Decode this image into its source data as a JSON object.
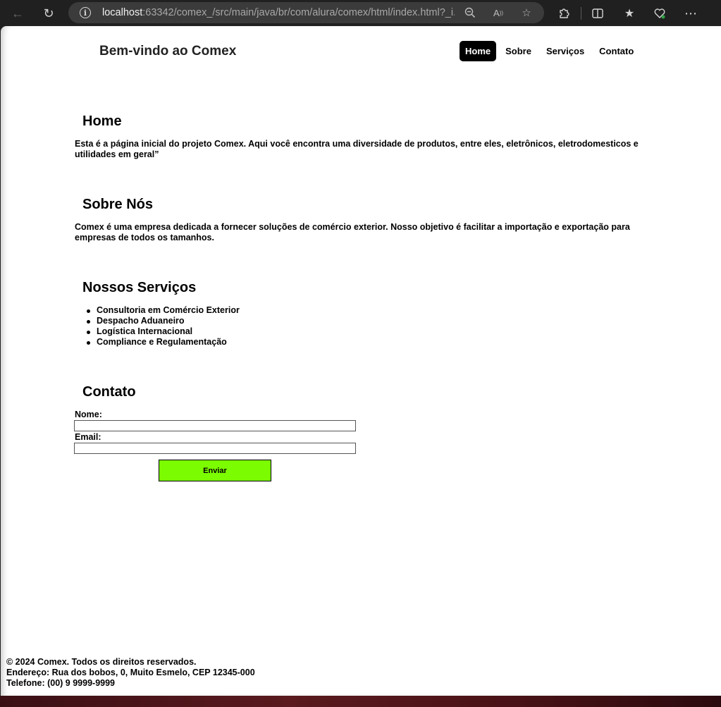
{
  "browser": {
    "url_host": "localhost",
    "url_rest": ":63342/comex_/src/main/java/br/com/alura/comex/html/index.html?_i...",
    "icons": [
      "back-icon",
      "refresh-icon",
      "info-icon",
      "zoom-out-icon",
      "read-aloud-icon",
      "favorite-star-icon",
      "extensions-icon",
      "split-screen-icon",
      "favorites-icon",
      "browser-essentials-icon",
      "more-icon"
    ]
  },
  "header": {
    "title": "Bem-vindo ao Comex",
    "nav": [
      {
        "label": "Home",
        "active": true
      },
      {
        "label": "Sobre",
        "active": false
      },
      {
        "label": "Serviços",
        "active": false
      },
      {
        "label": "Contato",
        "active": false
      }
    ]
  },
  "home": {
    "title": "Home",
    "text": "Esta é a página inicial do projeto Comex. Aqui você encontra uma diversidade de produtos, entre eles, eletrônicos, eletrodomesticos e utilidades em geral”"
  },
  "about": {
    "title": "Sobre Nós",
    "text": "Comex é uma empresa dedicada a fornecer soluções de comércio exterior. Nosso objetivo é facilitar a importação e exportação para empresas de todos os tamanhos."
  },
  "services": {
    "title": "Nossos Serviços",
    "items": [
      "Consultoria em Comércio Exterior",
      "Despacho Aduaneiro",
      "Logística Internacional",
      "Compliance e Regulamentação"
    ]
  },
  "contact": {
    "title": "Contato",
    "name_label": "Nome:",
    "name_value": "",
    "email_label": "Email:",
    "email_value": "",
    "submit_label": "Enviar",
    "submit_color": "#7cfc00"
  },
  "footer": {
    "copyright": "© 2024 Comex. Todos os direitos reservados.",
    "address": "Endereço: Rua dos bobos, 0, Muito Esmelo, CEP 12345-000",
    "phone": "Telefone: (00) 9 9999-9999"
  }
}
